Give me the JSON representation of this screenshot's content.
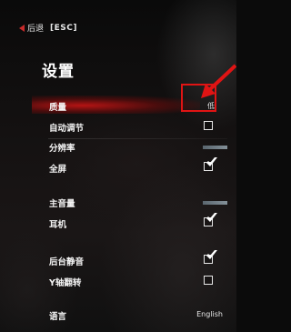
{
  "header": {
    "back_label": "后退",
    "esc_label": "[ESC]"
  },
  "title": "设置",
  "settings": {
    "quality": {
      "label": "质量",
      "value": "低"
    },
    "auto_adjust": {
      "label": "自动调节",
      "checked": false
    },
    "resolution": {
      "label": "分辨率"
    },
    "fullscreen": {
      "label": "全屏",
      "checked": true
    },
    "master_volume": {
      "label": "主音量"
    },
    "headphones": {
      "label": "耳机",
      "checked": true
    },
    "background_mute": {
      "label": "后台静音",
      "checked": true
    },
    "invert_y": {
      "label": "Y轴翻转",
      "checked": false
    },
    "language": {
      "label": "语言",
      "value": "English"
    }
  },
  "colors": {
    "highlight": "#be1414",
    "annotation": "#e01414",
    "slider": "#9fb0ba"
  }
}
